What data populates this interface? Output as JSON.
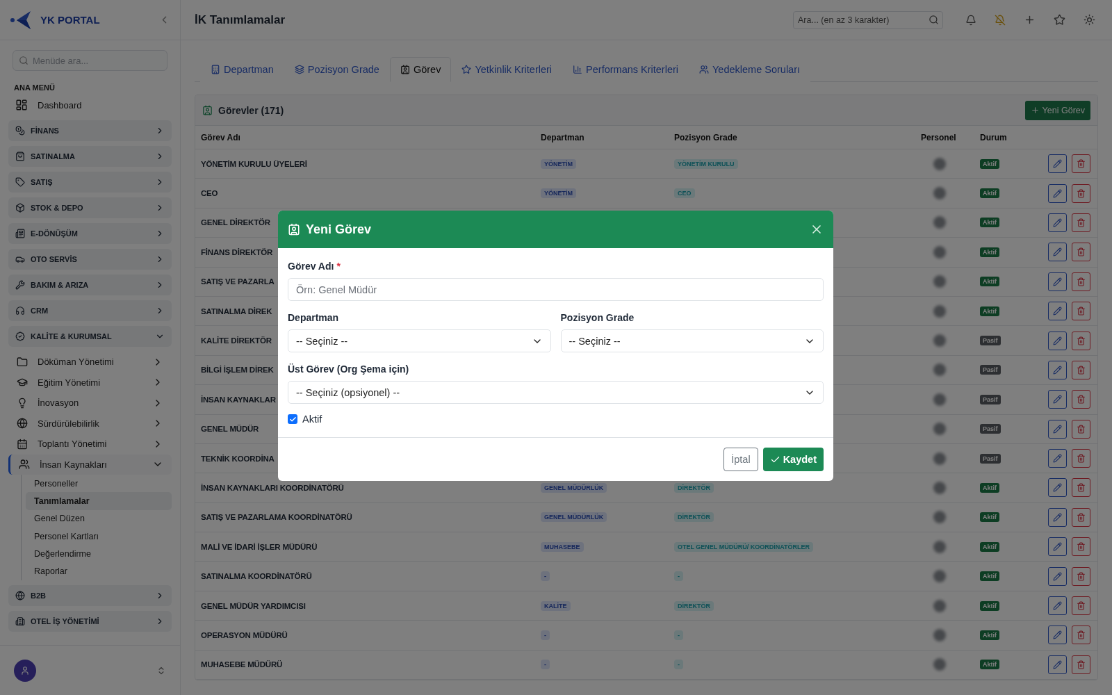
{
  "sidebar": {
    "brand": "YK PORTAL",
    "search": {
      "placeholder": "Menüde ara..."
    },
    "section_title": "ANA MENÜ",
    "items": [
      {
        "kind": "link",
        "label": "Dashboard"
      },
      {
        "kind": "group",
        "label": "FİNANS",
        "expanded": false
      },
      {
        "kind": "group",
        "label": "SATINALMA",
        "expanded": false
      },
      {
        "kind": "group",
        "label": "SATIŞ",
        "expanded": false
      },
      {
        "kind": "group",
        "label": "STOK & DEPO",
        "expanded": false
      },
      {
        "kind": "group",
        "label": "E-DÖNÜŞÜM",
        "expanded": false
      },
      {
        "kind": "group",
        "label": "OTO SERVİS",
        "expanded": false
      },
      {
        "kind": "group",
        "label": "BAKIM & ARIZA",
        "expanded": false
      },
      {
        "kind": "group",
        "label": "CRM",
        "expanded": false
      },
      {
        "kind": "group",
        "label": "KALİTE & KURUMSAL",
        "expanded": true,
        "children": [
          {
            "label": "Döküman Yönetimi",
            "expanded": false
          },
          {
            "label": "Eğitim Yönetimi",
            "expanded": false
          },
          {
            "label": "İnovasyon",
            "expanded": false
          },
          {
            "label": "Sürdürülebilirlik",
            "expanded": false
          },
          {
            "label": "Toplantı Yönetimi",
            "expanded": false
          },
          {
            "label": "İnsan Kaynakları",
            "expanded": true,
            "children": [
              {
                "label": "Personeller",
                "selected": false
              },
              {
                "label": "Tanımlamalar",
                "selected": true
              },
              {
                "label": "Genel Düzen",
                "selected": false
              },
              {
                "label": "Personel Kartları",
                "selected": false
              },
              {
                "label": "Değerlendirme",
                "selected": false
              },
              {
                "label": "Raporlar",
                "selected": false
              }
            ]
          }
        ]
      },
      {
        "kind": "group",
        "label": "B2B",
        "expanded": false
      },
      {
        "kind": "group",
        "label": "OTEL İŞ YÖNETİMİ",
        "expanded": false
      }
    ]
  },
  "header": {
    "title": "İK Tanımlamalar",
    "search": {
      "placeholder": "Ara... (en az 3 karakter)"
    }
  },
  "tabs": [
    {
      "label": "Departman",
      "selected": false
    },
    {
      "label": "Pozisyon Grade",
      "selected": false
    },
    {
      "label": "Görev",
      "selected": true
    },
    {
      "label": "Yetkinlik Kriterleri",
      "selected": false
    },
    {
      "label": "Performans Kriterleri",
      "selected": false
    },
    {
      "label": "Yedekleme Soruları",
      "selected": false
    }
  ],
  "card": {
    "title": "Görevler (171)",
    "new_button": "Yeni Görev"
  },
  "table": {
    "columns": [
      "Görev Adı",
      "Departman",
      "Pozisyon Grade",
      "Personel",
      "Durum"
    ],
    "rows": [
      {
        "name": "YÖNETİM KURULU ÜYELERİ",
        "department": "YÖNETİM",
        "grade": "YÖNETİM KURULU",
        "status": "Aktif",
        "active": true
      },
      {
        "name": "CEO",
        "department": "YÖNETİM",
        "grade": "CEO",
        "status": "Aktif",
        "active": true
      },
      {
        "name": "GENEL DİREKTÖR",
        "status": "Aktif",
        "active": true
      },
      {
        "name": "FİNANS DİREKTÖR",
        "status": "Aktif",
        "active": true
      },
      {
        "name": "SATIŞ VE PAZARLA",
        "status": "Aktif",
        "active": true
      },
      {
        "name": "SATINALMA DİREK",
        "status": "Aktif",
        "active": true
      },
      {
        "name": "KALİTE DİREKTÖR",
        "status": "Pasif",
        "active": false
      },
      {
        "name": "BİLGİ İŞLEM DİREK",
        "status": "Pasif",
        "active": false
      },
      {
        "name": "İNSAN KAYNAKLAR",
        "status": "Pasif",
        "active": false
      },
      {
        "name": "GENEL MÜDÜR",
        "status": "Pasif",
        "active": false
      },
      {
        "name": "TEKNİK KOORDİNA",
        "status": "Pasif",
        "active": false
      },
      {
        "name": "İNSAN KAYNAKLARI KOORDİNATÖRÜ",
        "department": "GENEL MÜDÜRLÜK",
        "grade": "DİREKTÖR",
        "status": "Aktif",
        "active": true
      },
      {
        "name": "SATIŞ VE PAZARLAMA KOORDİNATÖRÜ",
        "department": "GENEL MÜDÜRLÜK",
        "grade": "DİREKTÖR",
        "status": "Aktif",
        "active": true
      },
      {
        "name": "MALİ VE İDARİ İŞLER MÜDÜRÜ",
        "department": "MUHASEBE",
        "grade": "OTEL GENEL MÜDÜRÜ/ KOORDİNATÖRLER",
        "status": "Aktif",
        "active": true
      },
      {
        "name": "SATINALMA KOORDİNATÖRÜ",
        "department": "-",
        "grade": "-",
        "status": "Aktif",
        "active": true
      },
      {
        "name": "GENEL MÜDÜR YARDIMCISI",
        "department": "KALİTE",
        "grade": "DİREKTÖR",
        "status": "Aktif",
        "active": true
      },
      {
        "name": "OPERASYON MÜDÜRÜ",
        "department": "-",
        "grade": "-",
        "status": "Aktif",
        "active": true
      },
      {
        "name": "MUHASEBE MÜDÜRÜ",
        "department": "-",
        "grade": "-",
        "status": "Aktif",
        "active": true
      }
    ]
  },
  "modal": {
    "title": "Yeni Görev",
    "name_field": {
      "label": "Görev Adı",
      "required_mark": "*",
      "placeholder": "Örn: Genel Müdür"
    },
    "department": {
      "label": "Departman",
      "value": "-- Seçiniz --"
    },
    "grade": {
      "label": "Pozisyon Grade",
      "value": "-- Seçiniz --"
    },
    "parent": {
      "label": "Üst Görev (Org Şema için)",
      "value": "-- Seçiniz (opsiyonel) --"
    },
    "active": {
      "label": "Aktif",
      "checked": true
    },
    "buttons": {
      "cancel": "İptal",
      "save": "Kaydet"
    }
  }
}
